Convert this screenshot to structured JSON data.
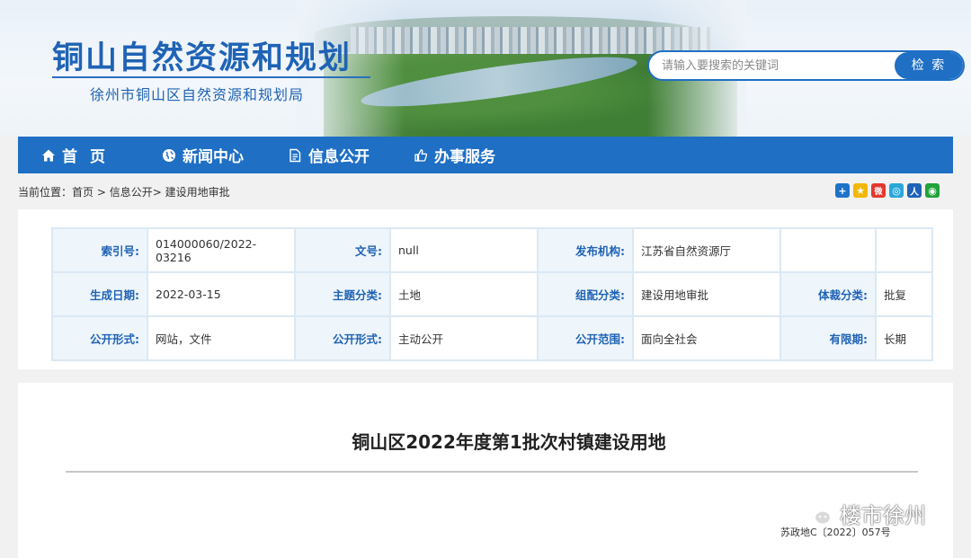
{
  "header": {
    "site_title": "铜山自然资源和规划",
    "site_subtitle": "徐州市铜山区自然资源和规划局",
    "search_placeholder": "请输入要搜索的关键词",
    "search_button": "检 索"
  },
  "nav": {
    "items": [
      {
        "label": "首页",
        "icon": "home-icon"
      },
      {
        "label": "新闻中心",
        "icon": "globe-icon"
      },
      {
        "label": "信息公开",
        "icon": "document-icon"
      },
      {
        "label": "办事服务",
        "icon": "thumbs-up-icon"
      }
    ]
  },
  "breadcrumb": {
    "prefix": "当前位置：",
    "items": [
      "首页",
      " > ",
      "信息公开",
      "> ",
      "建设用地审批"
    ]
  },
  "share": {
    "icons": [
      {
        "name": "share-more-icon",
        "color": "#1e73c9",
        "glyph": "+"
      },
      {
        "name": "qzone-icon",
        "color": "#f2b705",
        "glyph": "★"
      },
      {
        "name": "weibo-icon",
        "color": "#e4372c",
        "glyph": "微"
      },
      {
        "name": "tencent-weibo-icon",
        "color": "#2aa7d9",
        "glyph": "◎"
      },
      {
        "name": "renren-icon",
        "color": "#1e63b8",
        "glyph": "人"
      },
      {
        "name": "wechat-icon",
        "color": "#1fa33a",
        "glyph": "◉"
      }
    ]
  },
  "meta": {
    "rows": [
      [
        {
          "k": "索引号:",
          "v": "014000060/2022-03216"
        },
        {
          "k": "文号:",
          "v": "null"
        },
        {
          "k": "发布机构:",
          "v": "江苏省自然资源厅"
        },
        {
          "k": "",
          "v": ""
        }
      ],
      [
        {
          "k": "生成日期:",
          "v": "2022-03-15"
        },
        {
          "k": "主题分类:",
          "v": "土地"
        },
        {
          "k": "组配分类:",
          "v": "建设用地审批"
        },
        {
          "k": "体裁分类:",
          "v": "批复"
        }
      ],
      [
        {
          "k": "公开形式:",
          "v": "网站，文件"
        },
        {
          "k": "公开形式:",
          "v": "主动公开"
        },
        {
          "k": "公开范围:",
          "v": "面向全社会"
        },
        {
          "k": "有限期:",
          "v": "长期"
        }
      ]
    ]
  },
  "article": {
    "title": "铜山区2022年度第1批次村镇建设用地",
    "doc_number": "苏政地C〔2022〕057号"
  },
  "watermark": {
    "text": "楼市徐州"
  },
  "colors": {
    "brand_blue": "#1f6fc5",
    "label_blue": "#1f63b5",
    "cell_border": "#dbe9f4",
    "label_bg": "#eef5fb"
  }
}
